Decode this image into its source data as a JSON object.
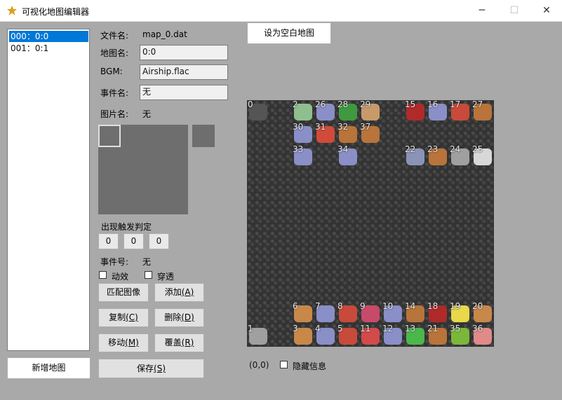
{
  "window": {
    "title": "可视化地图编辑器",
    "min": "─",
    "max": "☐",
    "close": "✕"
  },
  "map_list": {
    "items": [
      {
        "label": "000：0:0",
        "selected": true
      },
      {
        "label": "001：0:1",
        "selected": false
      }
    ]
  },
  "buttons": {
    "new_map": "新增地图",
    "set_blank": "设为空白地图",
    "match_image": "匹配图像",
    "add": "添加",
    "add_key": "(A)",
    "copy": "复制",
    "copy_key": "(C)",
    "delete": "删除",
    "delete_key": "(D)",
    "move": "移动",
    "move_key": "(M)",
    "overwrite": "覆盖",
    "overwrite_key": "(R)",
    "save": "保存",
    "save_key": "(S)"
  },
  "props": {
    "filename_label": "文件名:",
    "filename_value": "map_0.dat",
    "mapname_label": "地图名:",
    "mapname_value": "0:0",
    "bgm_label": "BGM:",
    "bgm_value": "Airship.flac",
    "eventname_label": "事件名:",
    "eventname_value": "无",
    "imagename_label": "图片名:",
    "imagename_value": "无",
    "trigger_label": "出现触发判定",
    "trigger_values": [
      "0",
      "0",
      "0"
    ],
    "eventno_label": "事件号:",
    "eventno_value": "无",
    "animate_label": "动效",
    "passthrough_label": "穿透"
  },
  "status": {
    "coords": "(0,0)",
    "hide_info_label": "隐藏信息"
  },
  "map_tiles": [
    {
      "n": "0",
      "c": "#555555",
      "r": 0,
      "col": 0
    },
    {
      "n": "2",
      "c": "#8fbf8f",
      "r": 0,
      "col": 2
    },
    {
      "n": "26",
      "c": "#8a8fc8",
      "r": 0,
      "col": 3
    },
    {
      "n": "28",
      "c": "#3f9a3f",
      "r": 0,
      "col": 4
    },
    {
      "n": "29",
      "c": "#c89a6a",
      "r": 0,
      "col": 5
    },
    {
      "n": "15",
      "c": "#b02a2a",
      "r": 0,
      "col": 7
    },
    {
      "n": "16",
      "c": "#8a8fc8",
      "r": 0,
      "col": 8
    },
    {
      "n": "17",
      "c": "#c84a3a",
      "r": 0,
      "col": 9
    },
    {
      "n": "27",
      "c": "#b8743a",
      "r": 0,
      "col": 10
    },
    {
      "n": "30",
      "c": "#8a8fc8",
      "r": 1,
      "col": 2
    },
    {
      "n": "31",
      "c": "#d24a3a",
      "r": 1,
      "col": 3
    },
    {
      "n": "32",
      "c": "#b8743a",
      "r": 1,
      "col": 4
    },
    {
      "n": "37",
      "c": "#b8743a",
      "r": 1,
      "col": 5
    },
    {
      "n": "33",
      "c": "#8a8fc8",
      "r": 2,
      "col": 2
    },
    {
      "n": "34",
      "c": "#8a8fc8",
      "r": 2,
      "col": 4
    },
    {
      "n": "22",
      "c": "#8a94b8",
      "r": 2,
      "col": 7
    },
    {
      "n": "23",
      "c": "#b8743a",
      "r": 2,
      "col": 8
    },
    {
      "n": "24",
      "c": "#a0a0a0",
      "r": 2,
      "col": 9
    },
    {
      "n": "25",
      "c": "#d8d8d8",
      "r": 2,
      "col": 10
    },
    {
      "n": "6",
      "c": "#c8884a",
      "r": 9,
      "col": 2
    },
    {
      "n": "7",
      "c": "#8a8fc8",
      "r": 9,
      "col": 3
    },
    {
      "n": "8",
      "c": "#c84a3a",
      "r": 9,
      "col": 4
    },
    {
      "n": "9",
      "c": "#c84a6a",
      "r": 9,
      "col": 5
    },
    {
      "n": "10",
      "c": "#8a8fc8",
      "r": 9,
      "col": 6
    },
    {
      "n": "14",
      "c": "#b8743a",
      "r": 9,
      "col": 7
    },
    {
      "n": "18",
      "c": "#b02a2a",
      "r": 9,
      "col": 8
    },
    {
      "n": "19",
      "c": "#e8d84a",
      "r": 9,
      "col": 9
    },
    {
      "n": "20",
      "c": "#c8884a",
      "r": 9,
      "col": 10
    },
    {
      "n": "1",
      "c": "#a0a0a0",
      "r": 10,
      "col": 0
    },
    {
      "n": "3",
      "c": "#c8884a",
      "r": 10,
      "col": 2
    },
    {
      "n": "4",
      "c": "#8a8fc8",
      "r": 10,
      "col": 3
    },
    {
      "n": "5",
      "c": "#c84a3a",
      "r": 10,
      "col": 4
    },
    {
      "n": "11",
      "c": "#d24a4a",
      "r": 10,
      "col": 5
    },
    {
      "n": "12",
      "c": "#8a8fc8",
      "r": 10,
      "col": 6
    },
    {
      "n": "13",
      "c": "#4ab84a",
      "r": 10,
      "col": 7
    },
    {
      "n": "21",
      "c": "#b8743a",
      "r": 10,
      "col": 8
    },
    {
      "n": "35",
      "c": "#7ab83a",
      "r": 10,
      "col": 9
    },
    {
      "n": "36",
      "c": "#e08a8a",
      "r": 10,
      "col": 10
    }
  ]
}
